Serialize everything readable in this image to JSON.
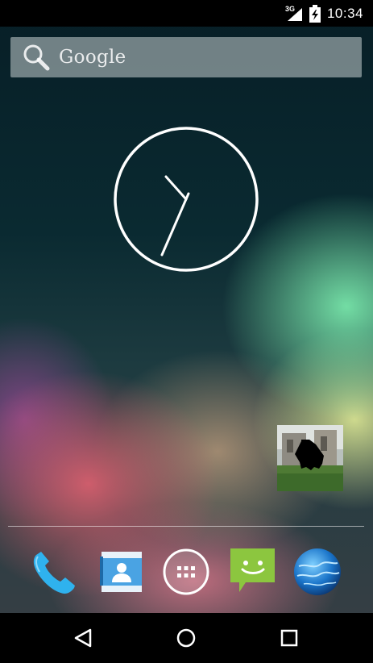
{
  "status_bar": {
    "network_type": "3G",
    "time": "10:34",
    "icons": [
      "signal-icon",
      "battery-charging-icon"
    ]
  },
  "search_widget": {
    "label": "Google",
    "icon": "search-icon"
  },
  "clock_widget": {
    "type": "analog",
    "hour": 10,
    "minute": 34
  },
  "photo_widget": {
    "description": "photo-frame"
  },
  "dock": {
    "items": [
      {
        "name": "phone",
        "icon": "phone-icon"
      },
      {
        "name": "contacts",
        "icon": "contacts-icon"
      },
      {
        "name": "all-apps",
        "icon": "app-drawer-icon"
      },
      {
        "name": "messaging",
        "icon": "messaging-icon"
      },
      {
        "name": "browser",
        "icon": "globe-icon"
      }
    ]
  },
  "nav_bar": {
    "buttons": [
      "back-icon",
      "home-icon",
      "recents-icon"
    ]
  }
}
